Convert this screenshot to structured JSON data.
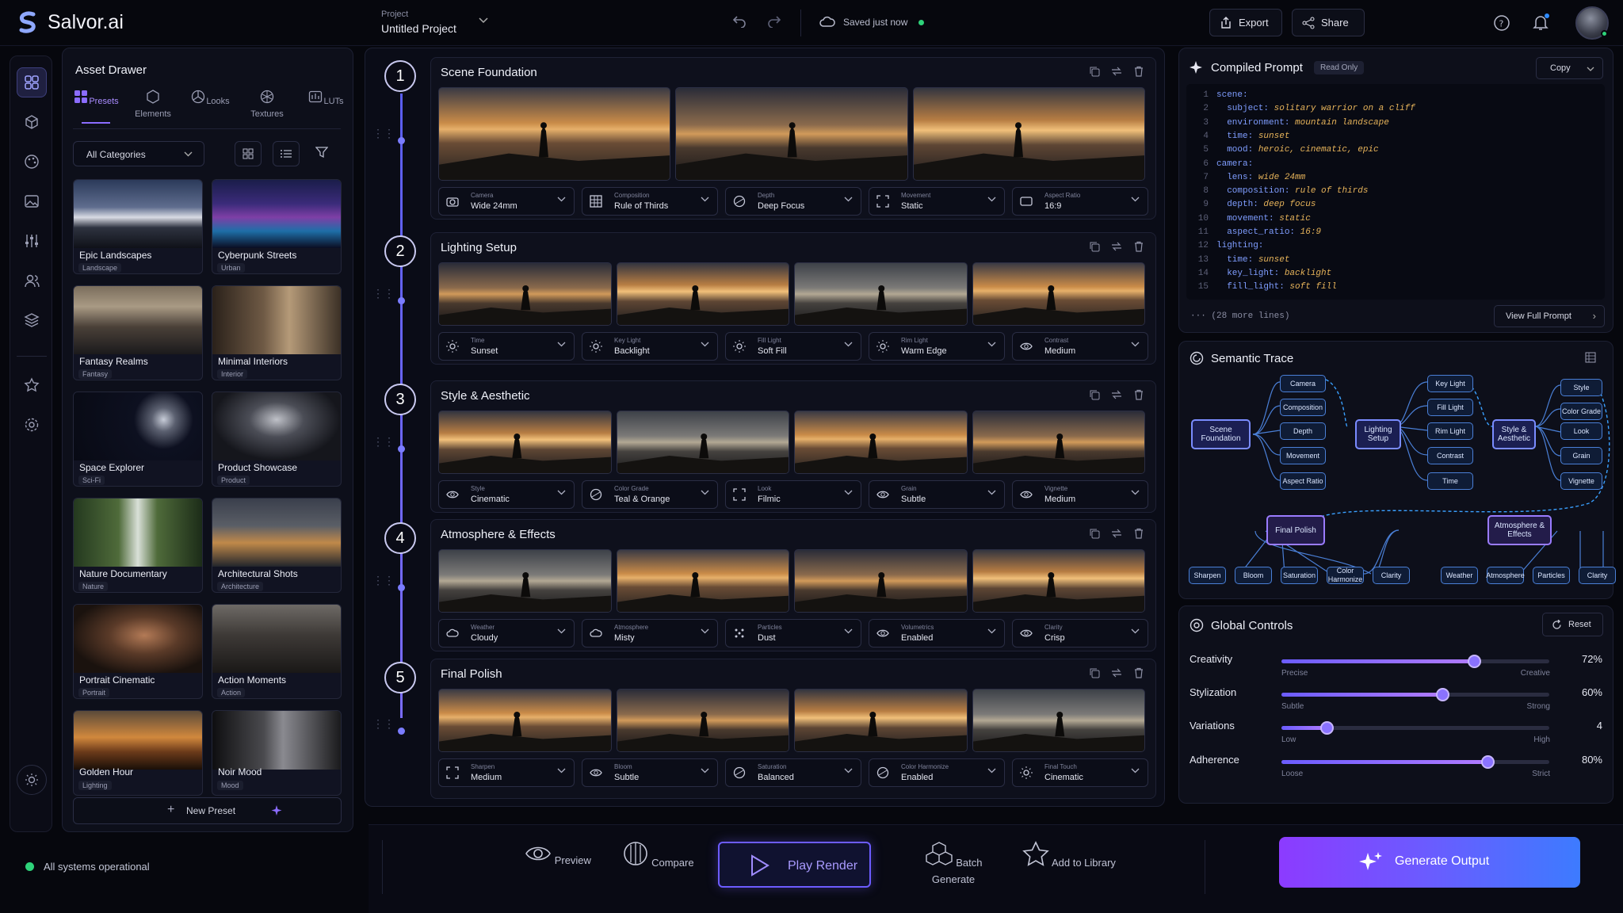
{
  "app": {
    "name": "Salvor.ai",
    "project_label": "Project",
    "project_name": "Untitled Project",
    "saved_status": "Saved just now"
  },
  "topbar": {
    "export": "Export",
    "share": "Share"
  },
  "drawer": {
    "title": "Asset Drawer",
    "tabs": [
      "Presets",
      "Elements",
      "Looks",
      "Textures",
      "LUTs"
    ],
    "category": "All Categories",
    "presets": [
      {
        "name": "Epic Landscapes",
        "tag": "Landscape"
      },
      {
        "name": "Cyberpunk Streets",
        "tag": "Urban"
      },
      {
        "name": "Fantasy Realms",
        "tag": "Fantasy"
      },
      {
        "name": "Minimal Interiors",
        "tag": "Interior"
      },
      {
        "name": "Space Explorer",
        "tag": "Sci-Fi"
      },
      {
        "name": "Product Showcase",
        "tag": "Product"
      },
      {
        "name": "Nature Documentary",
        "tag": "Nature"
      },
      {
        "name": "Architectural Shots",
        "tag": "Architecture"
      },
      {
        "name": "Portrait Cinematic",
        "tag": "Portrait"
      },
      {
        "name": "Action Moments",
        "tag": "Action"
      },
      {
        "name": "Golden Hour",
        "tag": "Lighting"
      },
      {
        "name": "Noir Mood",
        "tag": "Mood"
      }
    ],
    "new_preset": "New Preset"
  },
  "status": "All systems operational",
  "steps": [
    {
      "num": "1",
      "title": "Scene Foundation",
      "controls": [
        {
          "label": "Camera",
          "value": "Wide 24mm"
        },
        {
          "label": "Composition",
          "value": "Rule of Thirds"
        },
        {
          "label": "Depth",
          "value": "Deep Focus"
        },
        {
          "label": "Movement",
          "value": "Static"
        },
        {
          "label": "Aspect Ratio",
          "value": "16:9"
        }
      ]
    },
    {
      "num": "2",
      "title": "Lighting Setup",
      "controls": [
        {
          "label": "Time",
          "value": "Sunset"
        },
        {
          "label": "Key Light",
          "value": "Backlight"
        },
        {
          "label": "Fill Light",
          "value": "Soft Fill"
        },
        {
          "label": "Rim Light",
          "value": "Warm Edge"
        },
        {
          "label": "Contrast",
          "value": "Medium"
        }
      ]
    },
    {
      "num": "3",
      "title": "Style & Aesthetic",
      "controls": [
        {
          "label": "Style",
          "value": "Cinematic"
        },
        {
          "label": "Color Grade",
          "value": "Teal & Orange"
        },
        {
          "label": "Look",
          "value": "Filmic"
        },
        {
          "label": "Grain",
          "value": "Subtle"
        },
        {
          "label": "Vignette",
          "value": "Medium"
        }
      ]
    },
    {
      "num": "4",
      "title": "Atmosphere & Effects",
      "controls": [
        {
          "label": "Weather",
          "value": "Cloudy"
        },
        {
          "label": "Atmosphere",
          "value": "Misty"
        },
        {
          "label": "Particles",
          "value": "Dust"
        },
        {
          "label": "Volumetrics",
          "value": "Enabled"
        },
        {
          "label": "Clarity",
          "value": "Crisp"
        }
      ]
    },
    {
      "num": "5",
      "title": "Final Polish",
      "controls": [
        {
          "label": "Sharpen",
          "value": "Medium"
        },
        {
          "label": "Bloom",
          "value": "Subtle"
        },
        {
          "label": "Saturation",
          "value": "Balanced"
        },
        {
          "label": "Color Harmonize",
          "value": "Enabled"
        },
        {
          "label": "Final Touch",
          "value": "Cinematic"
        }
      ]
    }
  ],
  "prompt": {
    "title": "Compiled Prompt",
    "badge": "Read Only",
    "copy": "Copy",
    "more": "··· (28 more lines)",
    "view_full": "View Full Prompt",
    "lines": [
      {
        "n": "1",
        "k": "scene:",
        "v": ""
      },
      {
        "n": "2",
        "k": "  subject: ",
        "v": "solitary warrior on a cliff"
      },
      {
        "n": "3",
        "k": "  environment: ",
        "v": "mountain landscape"
      },
      {
        "n": "4",
        "k": "  time: ",
        "v": "sunset"
      },
      {
        "n": "5",
        "k": "  mood: ",
        "v": "heroic, cinematic, epic"
      },
      {
        "n": "6",
        "k": "camera:",
        "v": ""
      },
      {
        "n": "7",
        "k": "  lens: ",
        "v": "wide 24mm"
      },
      {
        "n": "8",
        "k": "  composition: ",
        "v": "rule of thirds"
      },
      {
        "n": "9",
        "k": "  depth: ",
        "v": "deep focus"
      },
      {
        "n": "10",
        "k": "  movement: ",
        "v": "static"
      },
      {
        "n": "11",
        "k": "  aspect_ratio: ",
        "v": "16:9"
      },
      {
        "n": "12",
        "k": "lighting:",
        "v": ""
      },
      {
        "n": "13",
        "k": "  time: ",
        "v": "sunset"
      },
      {
        "n": "14",
        "k": "  key_light: ",
        "v": "backlight"
      },
      {
        "n": "15",
        "k": "  fill_light: ",
        "v": "soft fill"
      }
    ]
  },
  "trace": {
    "title": "Semantic Trace",
    "scene": "Scene Foundation",
    "lighting": "Lighting Setup",
    "style": "Style & Aesthetic",
    "final": "Final Polish",
    "atmo": "Atmosphere & Effects",
    "scene_children": [
      "Camera",
      "Composition",
      "Depth",
      "Movement",
      "Aspect Ratio"
    ],
    "light_children": [
      "Key Light",
      "Fill Light",
      "Rim Light",
      "Contrast",
      "Time"
    ],
    "style_children": [
      "Style",
      "Color Grade",
      "Look",
      "Grain",
      "Vignette"
    ],
    "final_children": [
      "Sharpen",
      "Bloom",
      "Saturation",
      "Color Harmonize",
      "Clarity"
    ],
    "atmo_children": [
      "Weather",
      "Atmosphere",
      "Particles",
      "Clarity"
    ]
  },
  "global": {
    "title": "Global Controls",
    "reset": "Reset",
    "sliders": [
      {
        "label": "Creativity",
        "value": "72%",
        "min": "Precise",
        "max": "Creative",
        "level": 0.72
      },
      {
        "label": "Stylization",
        "value": "60%",
        "min": "Subtle",
        "max": "Strong",
        "level": 0.6
      },
      {
        "label": "Variations",
        "value": "4",
        "min": "Low",
        "max": "High",
        "level": 0.17
      },
      {
        "label": "Adherence",
        "value": "80%",
        "min": "Loose",
        "max": "Strict",
        "level": 0.77
      }
    ]
  },
  "bottom": {
    "preview": "Preview",
    "compare": "Compare",
    "play": "Play Render",
    "batch": "Batch Generate",
    "library": "Add to Library",
    "generate": "Generate Output"
  }
}
